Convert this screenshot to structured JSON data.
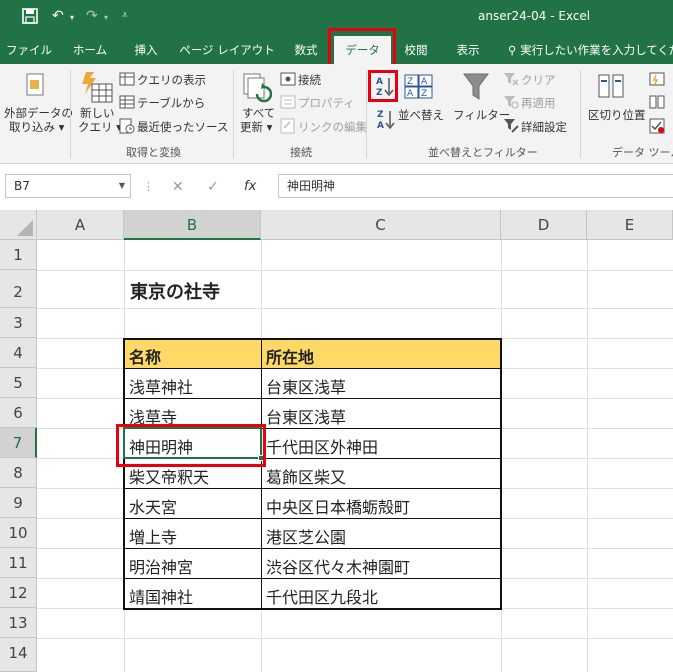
{
  "titlebar": {
    "title": "anser24-04  -  Excel"
  },
  "tabs": [
    {
      "label": "ファイル"
    },
    {
      "label": "ホーム"
    },
    {
      "label": "挿入"
    },
    {
      "label": "ページ レイアウト"
    },
    {
      "label": "数式"
    },
    {
      "label": "データ"
    },
    {
      "label": "校閲"
    },
    {
      "label": "表示"
    },
    {
      "label": "実行したい作業を入力してくだ"
    }
  ],
  "active_tab": "データ",
  "ribbon": {
    "external_data": {
      "line1": "外部データの",
      "line2": "取り込み"
    },
    "new_query": {
      "line1": "新しい",
      "line2": "クエリ"
    },
    "show_queries": "クエリの表示",
    "from_table": "テーブルから",
    "recent_sources": "最近使ったソース",
    "group_get_transform": "取得と変換",
    "refresh_all": {
      "line1": "すべて",
      "line2": "更新"
    },
    "connections": "接続",
    "properties": "プロパティ",
    "edit_links": "リンクの編集",
    "group_connections": "接続",
    "sort": "並べ替え",
    "filter": "フィルター",
    "clear": "クリア",
    "reapply": "再適用",
    "advanced": "詳細設定",
    "group_sort_filter": "並べ替えとフィルター",
    "text_to_columns": "区切り位置",
    "group_data_tools": "データ ツール"
  },
  "formula_bar": {
    "name_box": "B7",
    "formula": "神田明神"
  },
  "sheet": {
    "columns": [
      "A",
      "B",
      "C",
      "D",
      "E"
    ],
    "rows": [
      "1",
      "2",
      "3",
      "4",
      "5",
      "6",
      "7",
      "8",
      "9",
      "10",
      "11",
      "12",
      "13",
      "14"
    ],
    "selected_column": "B",
    "selected_row": "7",
    "title": "東京の社寺",
    "table_headers": [
      "名称",
      "所在地"
    ],
    "table_rows": [
      [
        "浅草神社",
        "台東区浅草"
      ],
      [
        "浅草寺",
        "台東区浅草"
      ],
      [
        "神田明神",
        "千代田区外神田"
      ],
      [
        "柴又帝釈天",
        "葛飾区柴又"
      ],
      [
        "水天宮",
        "中央区日本橋蛎殻町"
      ],
      [
        "増上寺",
        "港区芝公園"
      ],
      [
        "明治神宮",
        "渋谷区代々木神園町"
      ],
      [
        "靖国神社",
        "千代田区九段北"
      ]
    ]
  },
  "colors": {
    "excel_green": "#217346",
    "header_fill": "#ffd966",
    "highlight_red": "#e60012"
  }
}
